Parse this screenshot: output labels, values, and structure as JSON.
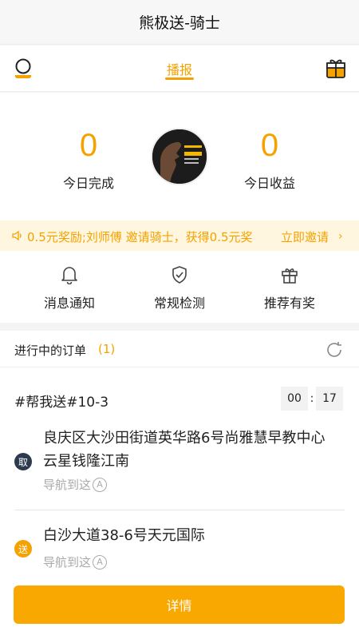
{
  "header": {
    "title": "熊极送-骑士"
  },
  "tabs": {
    "active_label": "播报"
  },
  "stats": {
    "completed_value": "0",
    "completed_label": "今日完成",
    "income_value": "0",
    "income_label": "今日收益"
  },
  "ticker": {
    "text": "0.5元奖励;刘师傅 邀请骑士，获得0.5元奖",
    "link": "立即邀请",
    "chevron": "›"
  },
  "quick_actions": {
    "items": [
      {
        "label": "消息通知",
        "icon": "bell-icon"
      },
      {
        "label": "常规检测",
        "icon": "shield-check-icon"
      },
      {
        "label": "推荐有奖",
        "icon": "gift-icon"
      }
    ]
  },
  "orders": {
    "title": "进行中的订单",
    "count": "(1)",
    "order": {
      "id": "#帮我送#10-3",
      "timer_minutes": "00",
      "timer_sep": ":",
      "timer_seconds": "17",
      "pickup_badge": "取",
      "pickup_address": "良庆区大沙田街道英华路6号尚雅慧早教中心云星钱隆江南",
      "pickup_nav": "导航到这",
      "dropoff_badge": "送",
      "dropoff_address": "白沙大道38-6号天元国际",
      "dropoff_nav": "导航到这",
      "nav_symbol": "A"
    },
    "details_button": "详情"
  },
  "colors": {
    "accent": "#f5a200",
    "pickup_badge": "#2c3a50",
    "ticker_bg": "#fff6e0"
  }
}
